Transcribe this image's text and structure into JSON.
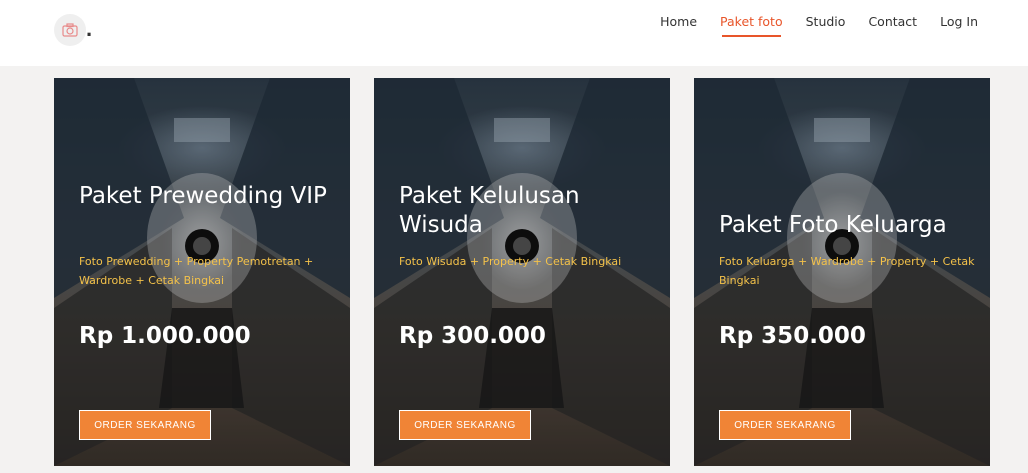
{
  "header": {
    "logo_icon": "camera-icon",
    "logo_text": ".",
    "nav": [
      {
        "label": "Home",
        "active": false
      },
      {
        "label": "Paket foto",
        "active": true
      },
      {
        "label": "Studio",
        "active": false
      },
      {
        "label": "Contact",
        "active": false
      },
      {
        "label": "Log In",
        "active": false
      }
    ]
  },
  "colors": {
    "accent": "#e8552a",
    "button": "#f08436",
    "description": "#f4c24a",
    "section_bg": "#f3f2f1"
  },
  "cards": [
    {
      "title": "Paket Prewedding VIP",
      "description": "Foto Prewedding + Property Pemotretan + Wardrobe + Cetak Bingkai",
      "price": "Rp 1.000.000",
      "button": "ORDER SEKARANG"
    },
    {
      "title": "Paket Kelulusan Wisuda",
      "description": "Foto Wisuda + Property + Cetak Bingkai",
      "price": "Rp 300.000",
      "button": "ORDER SEKARANG"
    },
    {
      "title": "Paket Foto Keluarga",
      "description": "Foto Keluarga + Wardrobe + Property + Cetak Bingkai",
      "price": "Rp 350.000",
      "button": "ORDER SEKARANG"
    }
  ]
}
